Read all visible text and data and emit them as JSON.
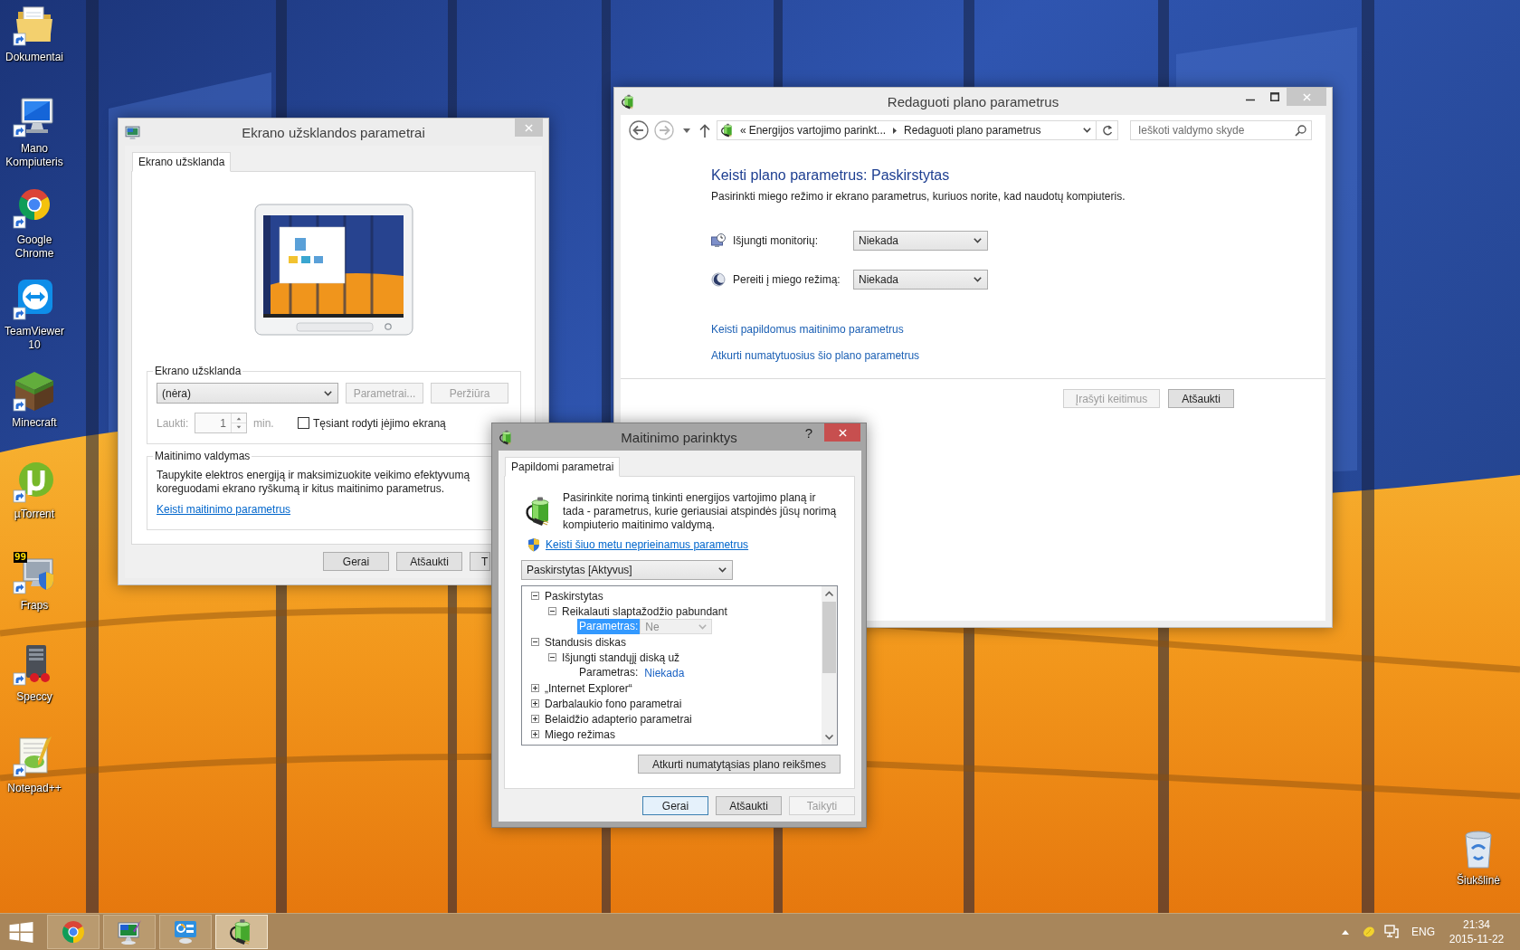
{
  "desktop": {
    "shortcuts": [
      {
        "label": "Dokumentai",
        "kind": "folder"
      },
      {
        "label": "Mano Kompiuteris",
        "kind": "computer"
      },
      {
        "label": "Google Chrome",
        "kind": "browser"
      },
      {
        "label": "TeamViewer 10",
        "kind": "remote"
      },
      {
        "label": "Minecraft",
        "kind": "block"
      },
      {
        "label": "µTorrent",
        "kind": "torrent"
      },
      {
        "label": "Fraps",
        "kind": "capture",
        "badge": "99"
      },
      {
        "label": "Speccy",
        "kind": "tower"
      },
      {
        "label": "Notepad++",
        "kind": "notepad"
      }
    ],
    "recycle_bin": {
      "label": "Šiukšlinė"
    }
  },
  "screensaver_window": {
    "title": "Ekrano užsklandos parametrai",
    "active": false,
    "tabs": [
      {
        "label": "Ekrano užsklanda",
        "selected": true
      }
    ],
    "screensaver_group": {
      "title": "Ekrano užsklanda",
      "dropdown": "(nėra)",
      "buttons": [
        {
          "label": "Parametrai...",
          "disabled": true
        },
        {
          "label": "Peržiūra",
          "disabled": true
        }
      ],
      "wait": {
        "label": "Laukti:",
        "value": "1",
        "unit": "min.",
        "disabled": true
      },
      "checkbox": {
        "label": "Tęsiant rodyti įėjimo ekraną",
        "checked": false
      }
    },
    "power_group": {
      "title": "Maitinimo valdymas",
      "text": "Taupykite elektros energiją ir maksimizuokite veikimo efektyvumą koreguodami ekrano ryškumą ir kitus maitinimo parametrus.",
      "link": "Keisti maitinimo parametrus"
    },
    "buttons": [
      {
        "label": "Gerai",
        "disabled": false
      },
      {
        "label": "Atšaukti",
        "disabled": false
      },
      {
        "label": "T",
        "disabled": false
      }
    ]
  },
  "plan_window": {
    "title": "Redaguoti plano parametrus",
    "active": false,
    "nav": {
      "back_disabled": false,
      "forward_disabled": true
    },
    "address": {
      "overflow": "«",
      "crumbs": [
        "Energijos vartojimo parinkt...",
        "Redaguoti plano parametrus"
      ]
    },
    "search": {
      "placeholder": "Ieškoti valdymo skyde"
    },
    "heading": "Keisti plano parametrus: Paskirstytas",
    "description": "Pasirinkti miego režimo ir ekrano parametrus, kuriuos norite, kad naudotų kompiuteris.",
    "settings": [
      {
        "kind": "display",
        "label": "Išjungti monitorių:",
        "value": "Niekada"
      },
      {
        "kind": "sleep",
        "label": "Pereiti į miego režimą:",
        "value": "Niekada"
      }
    ],
    "links": [
      "Keisti papildomus maitinimo parametrus",
      "Atkurti numatytuosius šio plano parametrus"
    ],
    "buttons": [
      {
        "label": "Įrašyti keitimus",
        "disabled": true
      },
      {
        "label": "Atšaukti",
        "disabled": false
      }
    ]
  },
  "power_dialog": {
    "title": "Maitinimo parinktys",
    "active": true,
    "help": "?",
    "tabs": [
      {
        "label": "Papildomi parametrai",
        "selected": true
      }
    ],
    "intro": "Pasirinkite norimą tinkinti energijos vartojimo planą ir tada - parametrus, kurie geriausiai atspindės jūsų norimą kompiuterio maitinimo valdymą.",
    "admin_link": "Keisti šiuo metu neprieinamus parametrus",
    "plan": "Paskirstytas [Aktyvus]",
    "tree": [
      {
        "kind": "group",
        "label": "Paskirstytas",
        "expanded": true,
        "selected": false,
        "children": [
          {
            "kind": "group",
            "label": "Reikalauti slaptažodžio pabundant",
            "expanded": true,
            "selected": false,
            "children": [
              {
                "kind": "setting",
                "label": "Parametras:",
                "value": "Ne",
                "selected": true,
                "disabled": true
              }
            ]
          }
        ]
      },
      {
        "kind": "group",
        "label": "Standusis diskas",
        "expanded": true,
        "selected": false,
        "children": [
          {
            "kind": "group",
            "label": "Išjungti standųjį diską už",
            "expanded": true,
            "selected": false,
            "children": [
              {
                "kind": "setting",
                "label": "Parametras:",
                "value": "Niekada",
                "selected": false,
                "disabled": false
              }
            ]
          }
        ]
      },
      {
        "kind": "group",
        "label": "„Internet Explorer“",
        "expanded": false,
        "selected": false
      },
      {
        "kind": "group",
        "label": "Darbalaukio fono parametrai",
        "expanded": false,
        "selected": false
      },
      {
        "kind": "group",
        "label": "Belaidžio adapterio parametrai",
        "expanded": false,
        "selected": false
      },
      {
        "kind": "group",
        "label": "Miego režimas",
        "expanded": false,
        "selected": false
      }
    ],
    "restore_button": "Atkurti numatytąsias plano reikšmes",
    "buttons": [
      {
        "label": "Gerai",
        "default": true,
        "disabled": false
      },
      {
        "label": "Atšaukti",
        "default": false,
        "disabled": false
      },
      {
        "label": "Taikyti",
        "default": false,
        "disabled": true
      }
    ]
  },
  "taskbar": {
    "buttons": [
      {
        "kind": "browser",
        "selected": false
      },
      {
        "kind": "display",
        "selected": false
      },
      {
        "kind": "panel",
        "selected": false
      },
      {
        "kind": "power",
        "selected": true
      }
    ],
    "language": "ENG",
    "time": "21:34",
    "date": "2015-11-22"
  }
}
